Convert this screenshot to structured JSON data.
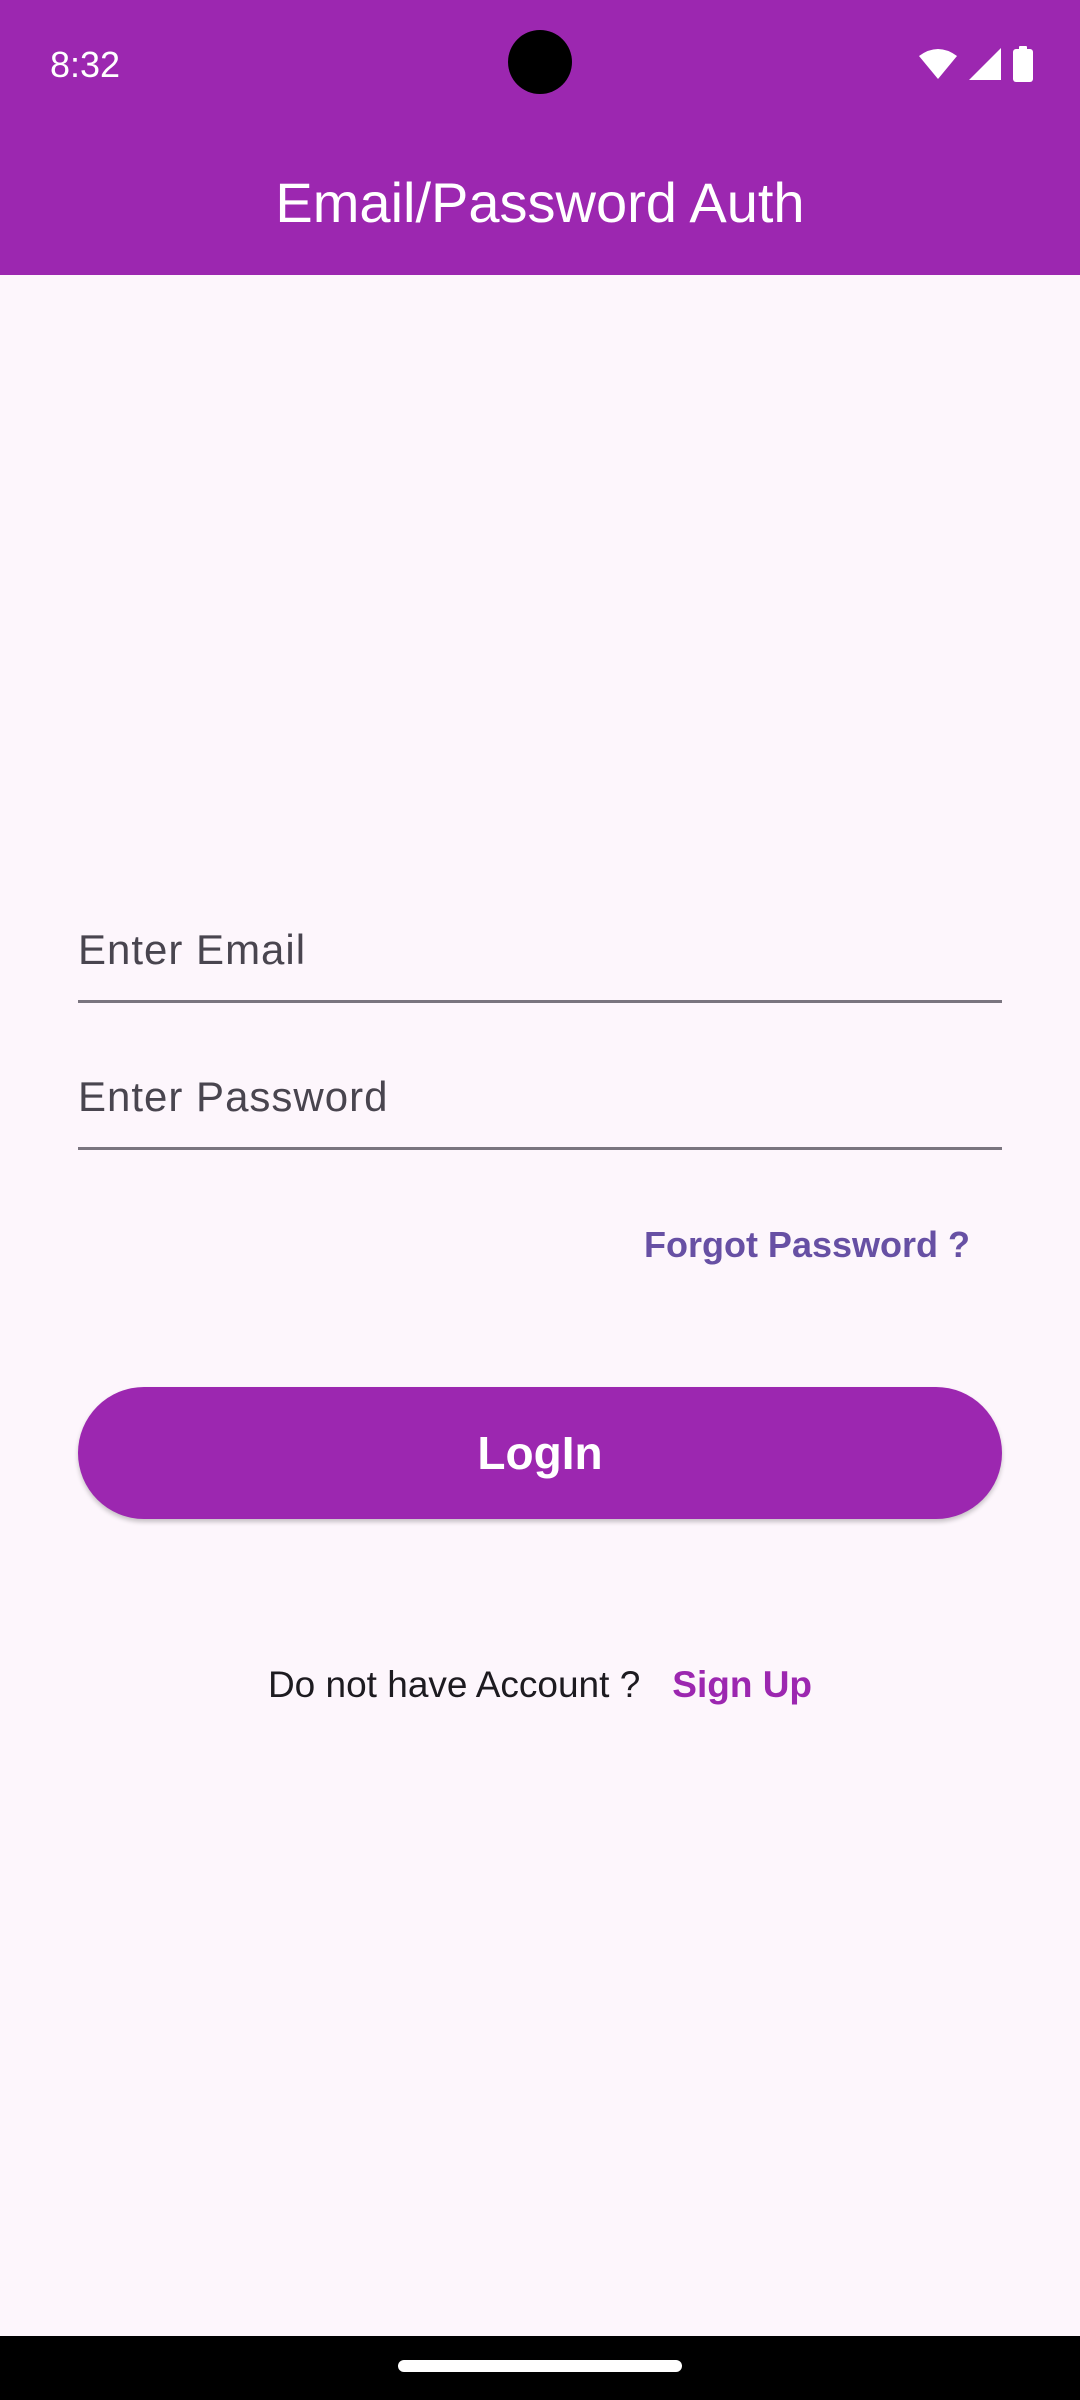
{
  "status_bar": {
    "time": "8:32",
    "icons": [
      "wifi-icon",
      "cellular-signal-icon",
      "battery-icon"
    ],
    "background": "#9C27B0"
  },
  "app_bar": {
    "title": "Email/Password Auth",
    "background": "#9C27B0"
  },
  "form": {
    "email": {
      "value": "",
      "placeholder": "Enter Email"
    },
    "password": {
      "value": "",
      "placeholder": "Enter Password"
    },
    "forgot_password_label": "Forgot Password ?",
    "login_label": "LogIn",
    "signup_prompt": "Do not have Account ?",
    "signup_label": "Sign Up"
  },
  "colors": {
    "primary": "#9C27B0",
    "link": "#6750A4",
    "background": "#FDF6FC"
  }
}
